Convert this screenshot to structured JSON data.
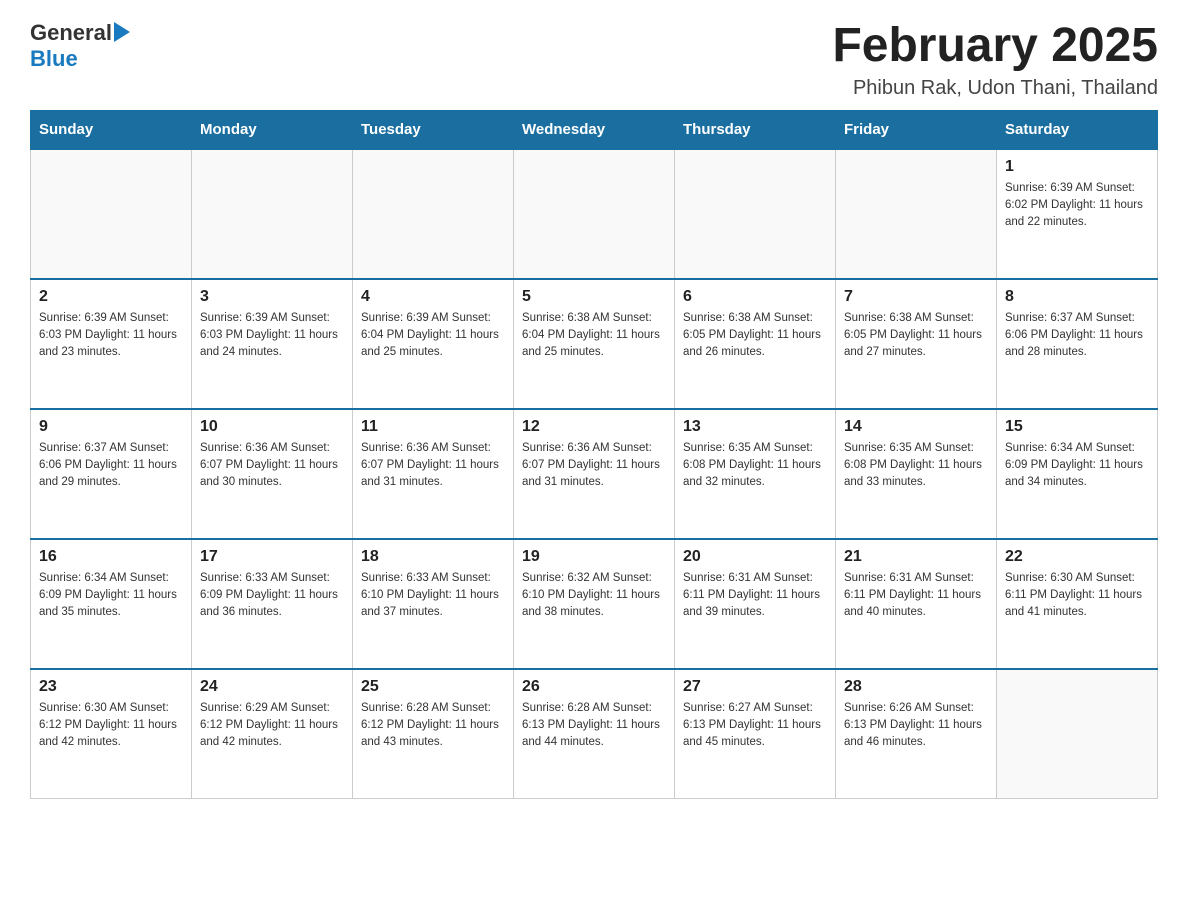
{
  "header": {
    "logo_general": "General",
    "logo_blue": "Blue",
    "month_title": "February 2025",
    "location": "Phibun Rak, Udon Thani, Thailand"
  },
  "weekdays": [
    "Sunday",
    "Monday",
    "Tuesday",
    "Wednesday",
    "Thursday",
    "Friday",
    "Saturday"
  ],
  "weeks": [
    [
      {
        "day": "",
        "info": ""
      },
      {
        "day": "",
        "info": ""
      },
      {
        "day": "",
        "info": ""
      },
      {
        "day": "",
        "info": ""
      },
      {
        "day": "",
        "info": ""
      },
      {
        "day": "",
        "info": ""
      },
      {
        "day": "1",
        "info": "Sunrise: 6:39 AM\nSunset: 6:02 PM\nDaylight: 11 hours and 22 minutes."
      }
    ],
    [
      {
        "day": "2",
        "info": "Sunrise: 6:39 AM\nSunset: 6:03 PM\nDaylight: 11 hours and 23 minutes."
      },
      {
        "day": "3",
        "info": "Sunrise: 6:39 AM\nSunset: 6:03 PM\nDaylight: 11 hours and 24 minutes."
      },
      {
        "day": "4",
        "info": "Sunrise: 6:39 AM\nSunset: 6:04 PM\nDaylight: 11 hours and 25 minutes."
      },
      {
        "day": "5",
        "info": "Sunrise: 6:38 AM\nSunset: 6:04 PM\nDaylight: 11 hours and 25 minutes."
      },
      {
        "day": "6",
        "info": "Sunrise: 6:38 AM\nSunset: 6:05 PM\nDaylight: 11 hours and 26 minutes."
      },
      {
        "day": "7",
        "info": "Sunrise: 6:38 AM\nSunset: 6:05 PM\nDaylight: 11 hours and 27 minutes."
      },
      {
        "day": "8",
        "info": "Sunrise: 6:37 AM\nSunset: 6:06 PM\nDaylight: 11 hours and 28 minutes."
      }
    ],
    [
      {
        "day": "9",
        "info": "Sunrise: 6:37 AM\nSunset: 6:06 PM\nDaylight: 11 hours and 29 minutes."
      },
      {
        "day": "10",
        "info": "Sunrise: 6:36 AM\nSunset: 6:07 PM\nDaylight: 11 hours and 30 minutes."
      },
      {
        "day": "11",
        "info": "Sunrise: 6:36 AM\nSunset: 6:07 PM\nDaylight: 11 hours and 31 minutes."
      },
      {
        "day": "12",
        "info": "Sunrise: 6:36 AM\nSunset: 6:07 PM\nDaylight: 11 hours and 31 minutes."
      },
      {
        "day": "13",
        "info": "Sunrise: 6:35 AM\nSunset: 6:08 PM\nDaylight: 11 hours and 32 minutes."
      },
      {
        "day": "14",
        "info": "Sunrise: 6:35 AM\nSunset: 6:08 PM\nDaylight: 11 hours and 33 minutes."
      },
      {
        "day": "15",
        "info": "Sunrise: 6:34 AM\nSunset: 6:09 PM\nDaylight: 11 hours and 34 minutes."
      }
    ],
    [
      {
        "day": "16",
        "info": "Sunrise: 6:34 AM\nSunset: 6:09 PM\nDaylight: 11 hours and 35 minutes."
      },
      {
        "day": "17",
        "info": "Sunrise: 6:33 AM\nSunset: 6:09 PM\nDaylight: 11 hours and 36 minutes."
      },
      {
        "day": "18",
        "info": "Sunrise: 6:33 AM\nSunset: 6:10 PM\nDaylight: 11 hours and 37 minutes."
      },
      {
        "day": "19",
        "info": "Sunrise: 6:32 AM\nSunset: 6:10 PM\nDaylight: 11 hours and 38 minutes."
      },
      {
        "day": "20",
        "info": "Sunrise: 6:31 AM\nSunset: 6:11 PM\nDaylight: 11 hours and 39 minutes."
      },
      {
        "day": "21",
        "info": "Sunrise: 6:31 AM\nSunset: 6:11 PM\nDaylight: 11 hours and 40 minutes."
      },
      {
        "day": "22",
        "info": "Sunrise: 6:30 AM\nSunset: 6:11 PM\nDaylight: 11 hours and 41 minutes."
      }
    ],
    [
      {
        "day": "23",
        "info": "Sunrise: 6:30 AM\nSunset: 6:12 PM\nDaylight: 11 hours and 42 minutes."
      },
      {
        "day": "24",
        "info": "Sunrise: 6:29 AM\nSunset: 6:12 PM\nDaylight: 11 hours and 42 minutes."
      },
      {
        "day": "25",
        "info": "Sunrise: 6:28 AM\nSunset: 6:12 PM\nDaylight: 11 hours and 43 minutes."
      },
      {
        "day": "26",
        "info": "Sunrise: 6:28 AM\nSunset: 6:13 PM\nDaylight: 11 hours and 44 minutes."
      },
      {
        "day": "27",
        "info": "Sunrise: 6:27 AM\nSunset: 6:13 PM\nDaylight: 11 hours and 45 minutes."
      },
      {
        "day": "28",
        "info": "Sunrise: 6:26 AM\nSunset: 6:13 PM\nDaylight: 11 hours and 46 minutes."
      },
      {
        "day": "",
        "info": ""
      }
    ]
  ]
}
